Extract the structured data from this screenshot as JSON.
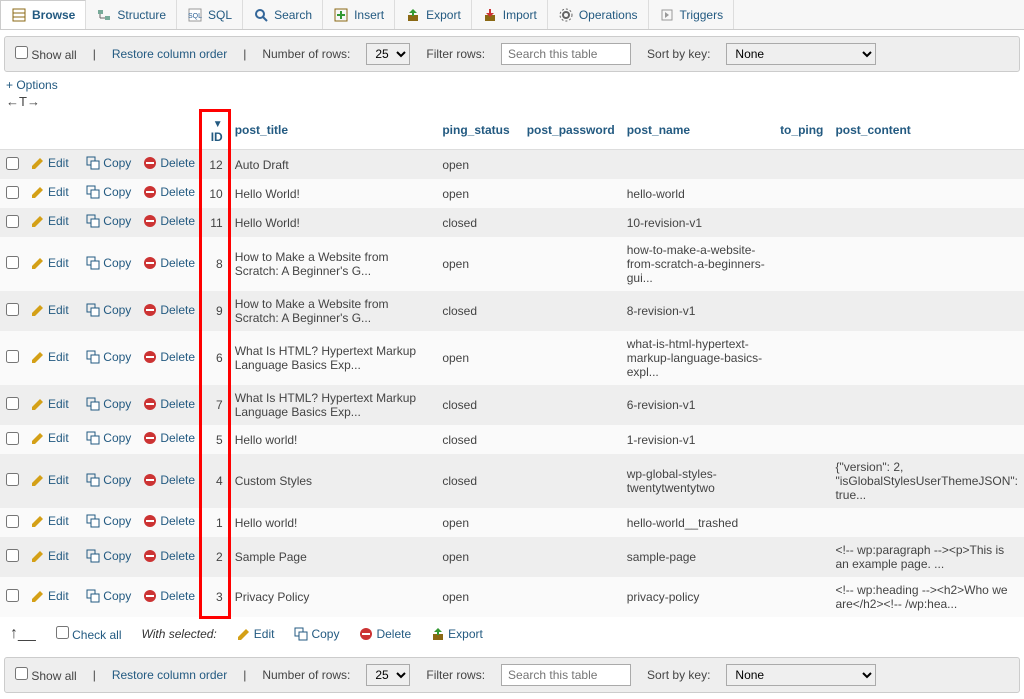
{
  "tabs": {
    "browse": "Browse",
    "structure": "Structure",
    "sql": "SQL",
    "search": "Search",
    "insert": "Insert",
    "export": "Export",
    "import": "Import",
    "operations": "Operations",
    "triggers": "Triggers"
  },
  "toolbar": {
    "show_all": "Show all",
    "restore": "Restore column order",
    "numrows_label": "Number of rows:",
    "numrows_value": "25",
    "filter_label": "Filter rows:",
    "filter_placeholder": "Search this table",
    "sortkey_label": "Sort by key:",
    "sortkey_value": "None"
  },
  "options_label": "+ Options",
  "arrow_label": "←T→",
  "headers": {
    "id": "ID",
    "post_title": "post_title",
    "ping_status": "ping_status",
    "post_password": "post_password",
    "post_name": "post_name",
    "to_ping": "to_ping",
    "post_content": "post_content"
  },
  "actions": {
    "edit": "Edit",
    "copy": "Copy",
    "delete": "Delete"
  },
  "rows": [
    {
      "id": "12",
      "post_title": "Auto Draft",
      "ping_status": "open",
      "post_name": "",
      "post_content": ""
    },
    {
      "id": "10",
      "post_title": "Hello World!",
      "ping_status": "open",
      "post_name": "hello-world",
      "post_content": ""
    },
    {
      "id": "11",
      "post_title": "Hello World!",
      "ping_status": "closed",
      "post_name": "10-revision-v1",
      "post_content": ""
    },
    {
      "id": "8",
      "post_title": "How to Make a Website from Scratch: A Beginner's G...",
      "ping_status": "open",
      "post_name": "how-to-make-a-website-from-scratch-a-beginners-gui...",
      "post_content": ""
    },
    {
      "id": "9",
      "post_title": "How to Make a Website from Scratch: A Beginner's G...",
      "ping_status": "closed",
      "post_name": "8-revision-v1",
      "post_content": ""
    },
    {
      "id": "6",
      "post_title": "What Is HTML? Hypertext Markup Language Basics Exp...",
      "ping_status": "open",
      "post_name": "what-is-html-hypertext-markup-language-basics-expl...",
      "post_content": ""
    },
    {
      "id": "7",
      "post_title": "What Is HTML? Hypertext Markup Language Basics Exp...",
      "ping_status": "closed",
      "post_name": "6-revision-v1",
      "post_content": ""
    },
    {
      "id": "5",
      "post_title": "Hello world!",
      "ping_status": "closed",
      "post_name": "1-revision-v1",
      "post_content": ""
    },
    {
      "id": "4",
      "post_title": "Custom Styles",
      "ping_status": "closed",
      "post_name": "wp-global-styles-twentytwentytwo",
      "post_content": "{\"version\": 2, \"isGlobalStylesUserThemeJSON\": true..."
    },
    {
      "id": "1",
      "post_title": "Hello world!",
      "ping_status": "open",
      "post_name": "hello-world__trashed",
      "post_content": ""
    },
    {
      "id": "2",
      "post_title": "Sample Page",
      "ping_status": "open",
      "post_name": "sample-page",
      "post_content": "<!-- wp:paragraph --><p>This is an example page. ..."
    },
    {
      "id": "3",
      "post_title": "Privacy Policy",
      "ping_status": "open",
      "post_name": "privacy-policy",
      "post_content": "<!-- wp:heading --><h2>Who we are</h2><!-- /wp:hea..."
    }
  ],
  "footer": {
    "check_all": "Check all",
    "with_selected": "With selected:",
    "edit": "Edit",
    "copy": "Copy",
    "delete": "Delete",
    "export": "Export"
  }
}
